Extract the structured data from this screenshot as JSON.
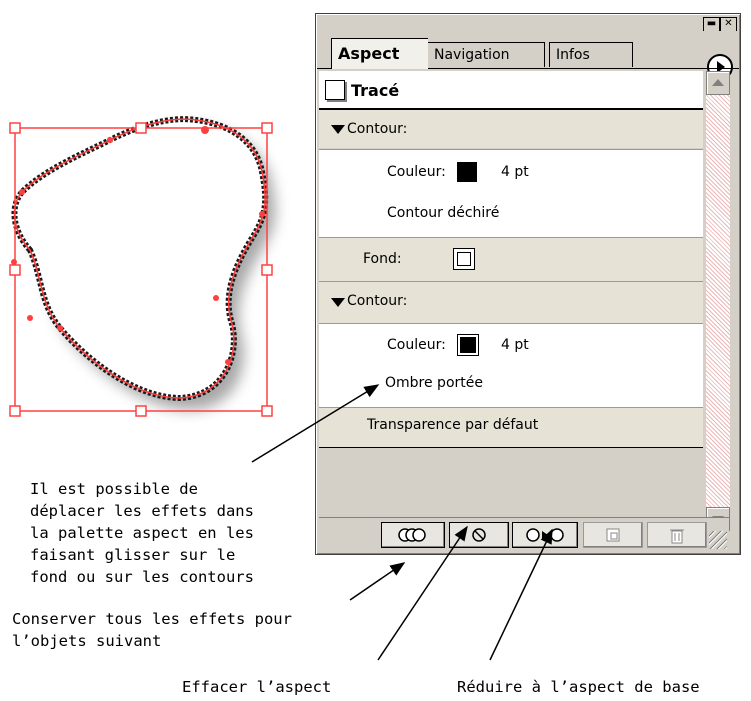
{
  "palette": {
    "tabs": [
      "Aspect",
      "Navigation",
      "Infos"
    ],
    "header": "Tracé",
    "rows": {
      "contour1": "Contour:",
      "couleur1_label": "Couleur:",
      "couleur1_size": "4 pt",
      "effet1": "Contour déchiré",
      "fond_label": "Fond:",
      "contour2": "Contour:",
      "couleur2_label": "Couleur:",
      "couleur2_size": "4 pt",
      "effet2": "Ombre portée",
      "transparence": "Transparence par défaut"
    },
    "icons": {
      "menu": "palette-menu-arrow-icon",
      "keep": "overlapping-circles-icon",
      "clear": "no-sign-icon",
      "reduce": "circle-arrow-circle-icon",
      "new": "new-item-icon",
      "trash": "trash-icon"
    }
  },
  "annotations": {
    "move_line1": "Il est possible de",
    "move_line2": "déplacer les effets dans",
    "move_line3": "la palette aspect en les",
    "move_line4": "faisant glisser sur le",
    "move_line5": "fond ou sur les contours",
    "keep_line1": "Conserver tous les effets pour",
    "keep_line2": "l’objets suivant",
    "clear": "Effacer l’aspect",
    "reduce": "Réduire à l’aspect de base"
  },
  "colors": {
    "selection": "#ff4040",
    "palette_bg": "#d4d0c8",
    "row_gray": "#e6e2d6"
  }
}
